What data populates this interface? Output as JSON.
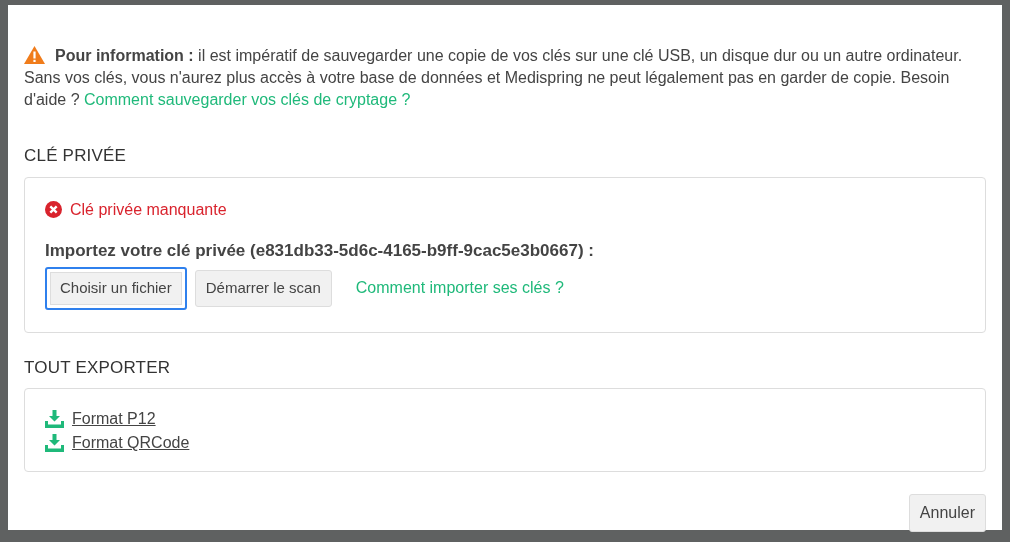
{
  "notice": {
    "text": "**Pour information :** il est impératif de sauvegarder une copie de vos clés sur une clé USB, un disque dur ou un autre ordinateur. Sans vos clés, vous n'aurez plus accès à votre base de données et Medispring ne peut légalement pas en garder de copie. Besoin d'aide ?",
    "link": "Comment sauvegarder vos clés de cryptage ?"
  },
  "private_key": {
    "heading": "CLÉ PRIVÉE",
    "error": "Clé privée manquante",
    "prompt": "Importez votre clé privée (e831db33-5d6c-4165-b9ff-9cac5e3b0667) :",
    "buttons": [
      {
        "label": "Choisir un fichier",
        "focused": true
      },
      {
        "label": "Démarrer le scan",
        "focused": false
      }
    ],
    "help_link": "Comment importer ses clés ?"
  },
  "export": {
    "heading": "TOUT EXPORTER",
    "links": [
      {
        "label": "Format P12"
      },
      {
        "label": "Format QRCode"
      }
    ]
  },
  "footer": {
    "buttons": [
      {
        "label": "Annuler"
      }
    ]
  }
}
